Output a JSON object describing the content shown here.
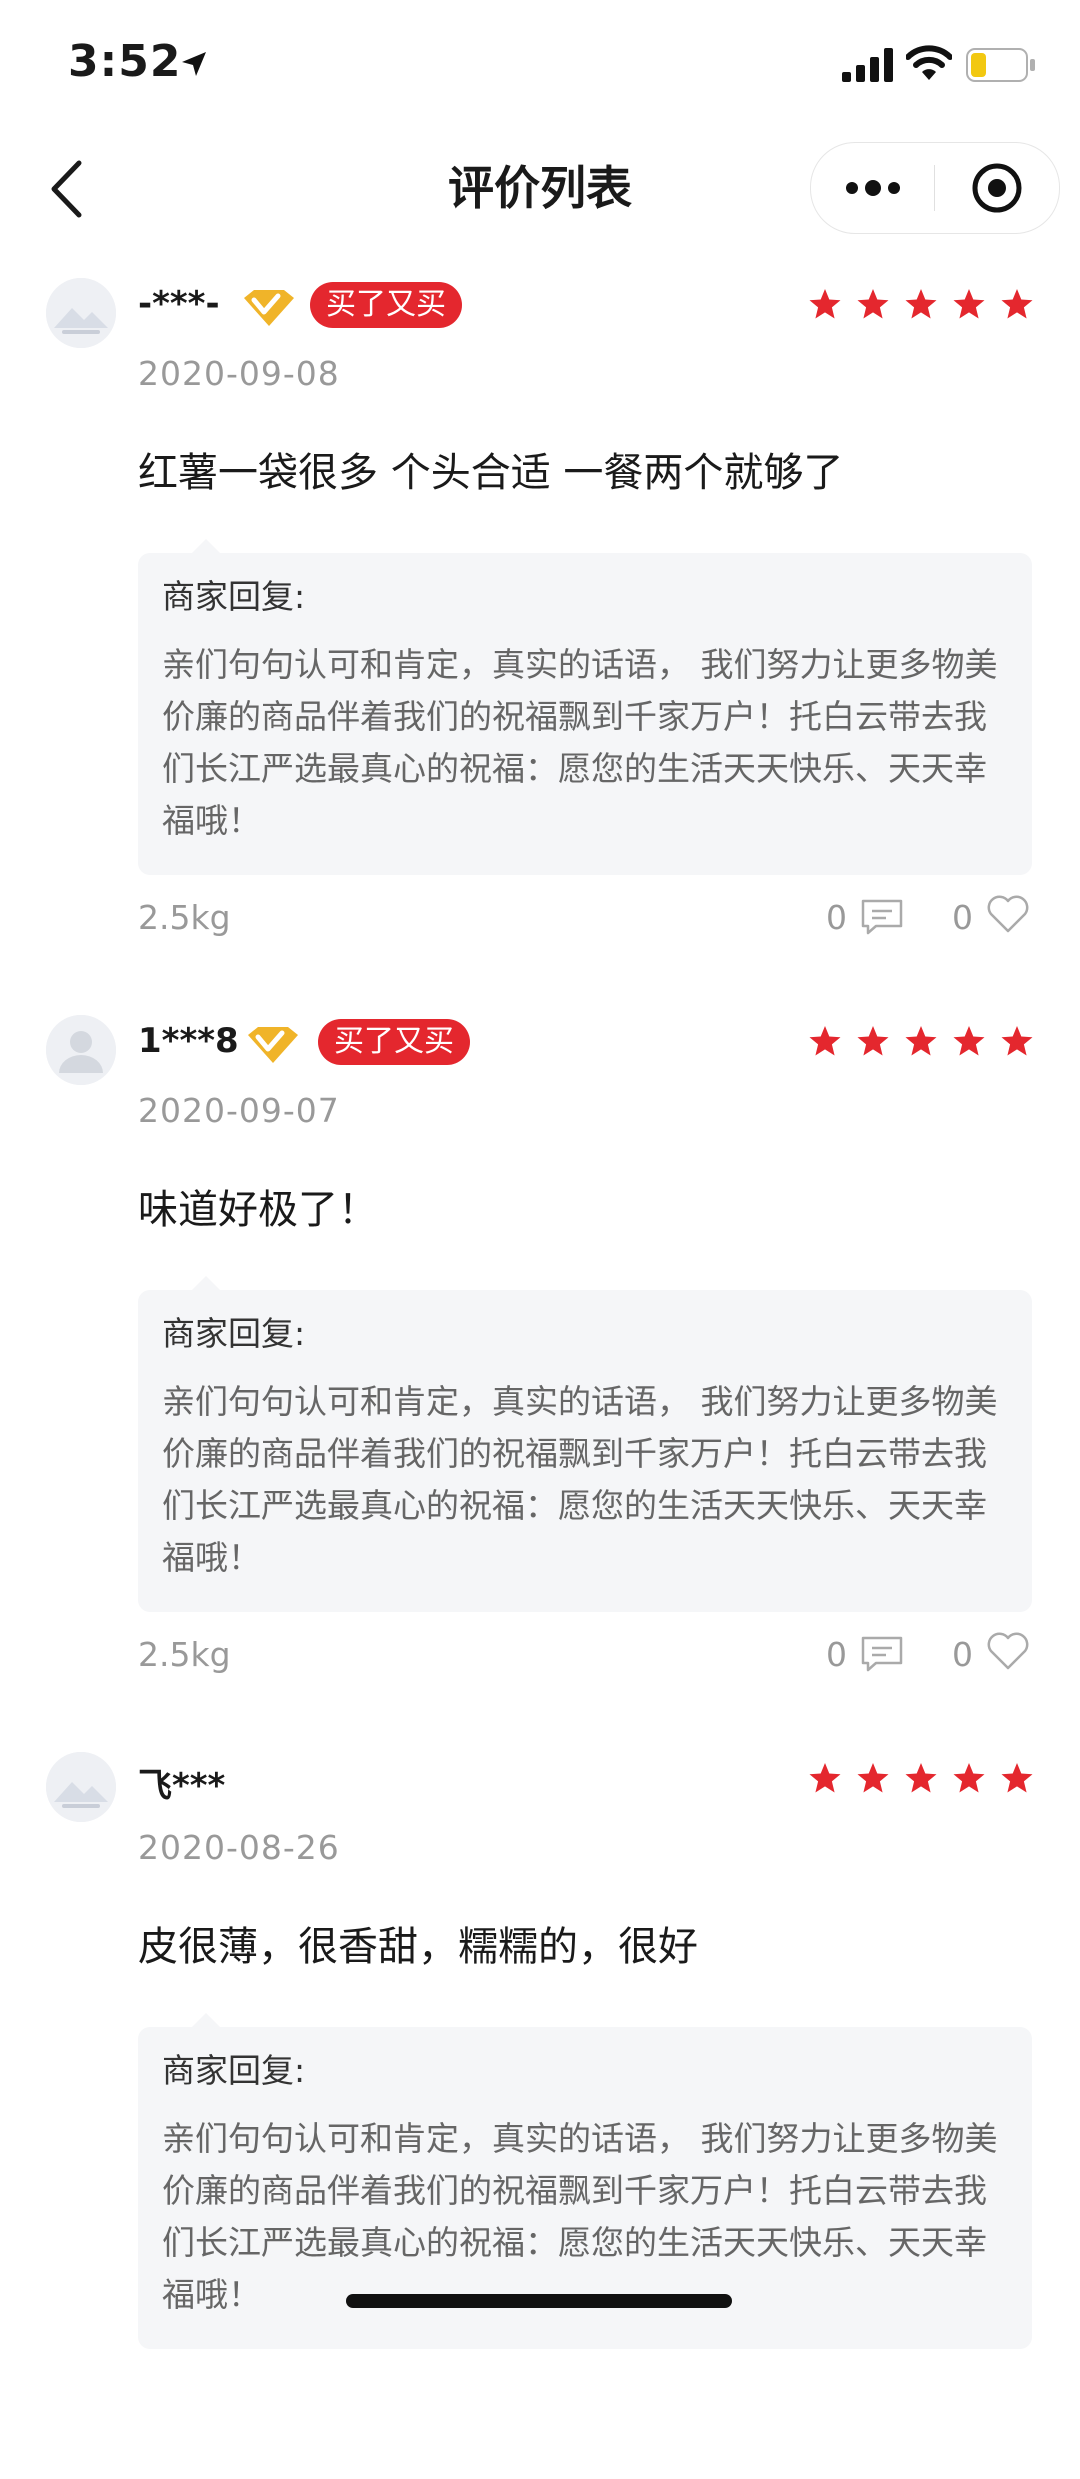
{
  "status_bar": {
    "time": "3:52"
  },
  "nav": {
    "title": "评价列表"
  },
  "reply_label": "商家回复:",
  "reviews": [
    {
      "username": "-***-",
      "vip": true,
      "badge": "买了又买",
      "rating": 5,
      "date": "2020-09-08",
      "content": "红薯一袋很多 个头合适 一餐两个就够了",
      "reply": "亲们句句认可和肯定，真实的话语， 我们努力让更多物美价廉的商品伴着我们的祝福飘到千家万户！托白云带去我们长江严选最真心的祝福：愿您的生活天天快乐、天天幸福哦！",
      "spec": "2.5kg",
      "comments": "0",
      "likes": "0"
    },
    {
      "username": "1***8",
      "vip": true,
      "badge": "买了又买",
      "rating": 5,
      "date": "2020-09-07",
      "content": "味道好极了！",
      "reply": "亲们句句认可和肯定，真实的话语， 我们努力让更多物美价廉的商品伴着我们的祝福飘到千家万户！托白云带去我们长江严选最真心的祝福：愿您的生活天天快乐、天天幸福哦！",
      "spec": "2.5kg",
      "comments": "0",
      "likes": "0"
    },
    {
      "username": "飞***",
      "vip": false,
      "badge": "",
      "rating": 5,
      "date": "2020-08-26",
      "content": "皮很薄，很香甜，糯糯的，很好",
      "reply": "亲们句句认可和肯定，真实的话语， 我们努力让更多物美价廉的商品伴着我们的祝福飘到千家万户！托白云带去我们长江严选最真心的祝福：愿您的生活天天快乐、天天幸福哦！",
      "spec": "",
      "comments": "",
      "likes": ""
    }
  ],
  "colors": {
    "accent_red": "#e4272e",
    "vip_gold": "#f0b429",
    "muted_text": "#999999",
    "reply_bg": "#f5f6f8"
  },
  "icons": [
    "location-arrow-icon",
    "signal-icon",
    "wifi-icon",
    "battery-icon",
    "back-icon",
    "more-icon",
    "close-target-icon",
    "vip-icon",
    "star-icon",
    "comment-icon",
    "heart-icon"
  ]
}
